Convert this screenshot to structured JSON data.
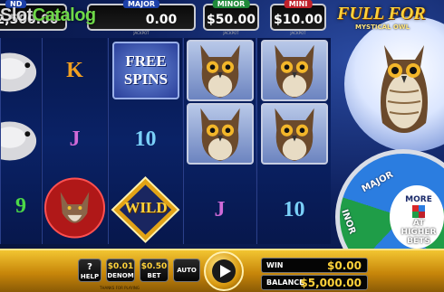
{
  "watermark": {
    "prefix": "Slot",
    "brand": "Catalog"
  },
  "game": {
    "title": "FULL FOR",
    "subtitle": "MYSTICAL OWL"
  },
  "jackpots": [
    {
      "tag": "ND",
      "amount": "2,500.00",
      "tag_color": "#1b3fa8"
    },
    {
      "tag": "MAJOR",
      "amount": "0.00",
      "tag_color": "#1b3fa8",
      "sub": "JACKPOT"
    },
    {
      "tag": "MINOR",
      "amount": "$50.00",
      "tag_color": "#1f8a3a",
      "sub": "JACKPOT"
    },
    {
      "tag": "MINI",
      "amount": "$10.00",
      "tag_color": "#c0202a",
      "sub": "JACKPOT"
    }
  ],
  "reels": {
    "symbols": {
      "k": "K",
      "j1": "J",
      "j2": "J",
      "ten1": "10",
      "ten2": "10",
      "nine": "9",
      "free": "FREE",
      "spins": "SPINS",
      "wild": "WILD"
    }
  },
  "wheel": {
    "major": "MAJOR",
    "minor": "INOR",
    "more": "MORE",
    "at_higher": "AT HIGHER",
    "bets": "BETS"
  },
  "controls": {
    "help": {
      "icon": "?",
      "label": "HELP"
    },
    "denom": {
      "value": "$0.01",
      "label": "DENOM"
    },
    "bet": {
      "value": "$0.50",
      "label": "BET"
    },
    "auto": {
      "label": "AUTO"
    },
    "win": {
      "label": "WIN",
      "value": "$0.00"
    },
    "balance": {
      "label": "BALANCE",
      "value": "$5,000.00"
    },
    "legal": "THANKS FOR PLAYING"
  },
  "colors": {
    "accent_gold": "#ffd23a",
    "reel_blue": "#0a2266",
    "bar_gold": "#e0a820"
  }
}
